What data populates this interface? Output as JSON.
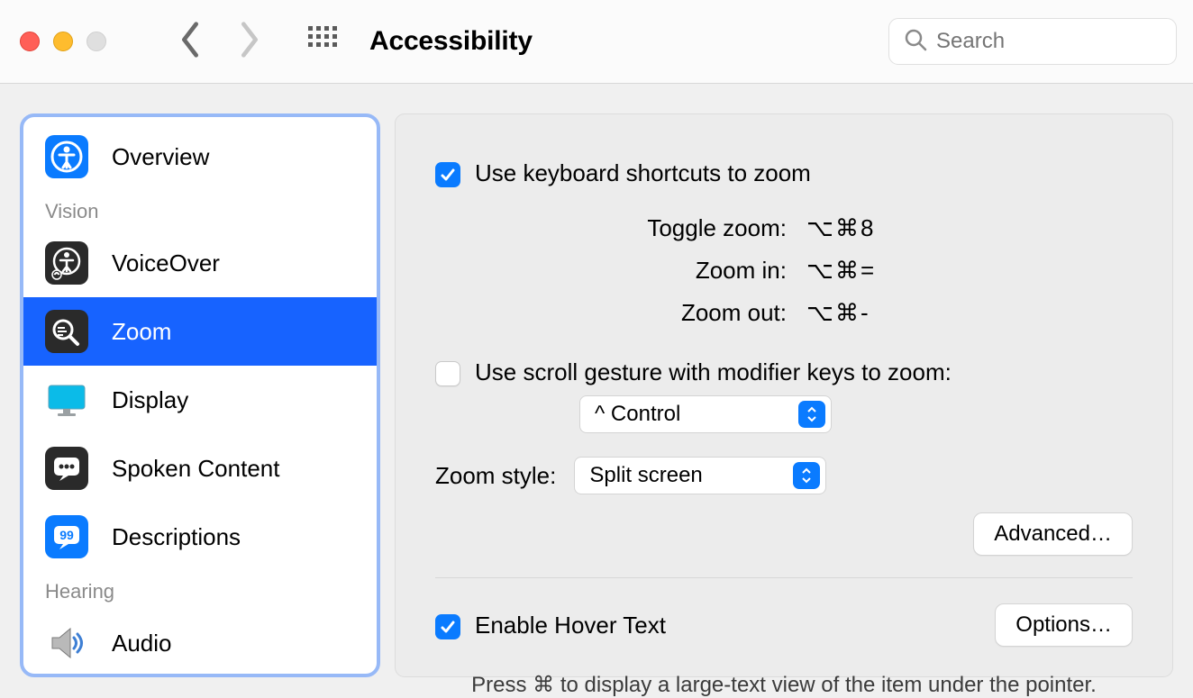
{
  "toolbar": {
    "title": "Accessibility",
    "search_placeholder": "Search"
  },
  "sidebar": {
    "overview": "Overview",
    "section_vision": "Vision",
    "voiceover": "VoiceOver",
    "zoom": "Zoom",
    "display": "Display",
    "spoken_content": "Spoken Content",
    "descriptions": "Descriptions",
    "section_hearing": "Hearing",
    "audio": "Audio"
  },
  "main": {
    "kb_shortcuts_label": "Use keyboard shortcuts to zoom",
    "shortcuts": {
      "toggle_label": "Toggle zoom:",
      "toggle_value": "⌥⌘8",
      "in_label": "Zoom in:",
      "in_value": "⌥⌘=",
      "out_label": "Zoom out:",
      "out_value": "⌥⌘-"
    },
    "scroll_gesture_label": "Use scroll gesture with modifier keys to zoom:",
    "modifier_value": "^ Control",
    "zoom_style_label": "Zoom style:",
    "zoom_style_value": "Split screen",
    "advanced_label": "Advanced…",
    "hover_text_label": "Enable Hover Text",
    "options_label": "Options…",
    "hover_hint": "Press ⌘ to display a large-text view of the item under the pointer."
  }
}
